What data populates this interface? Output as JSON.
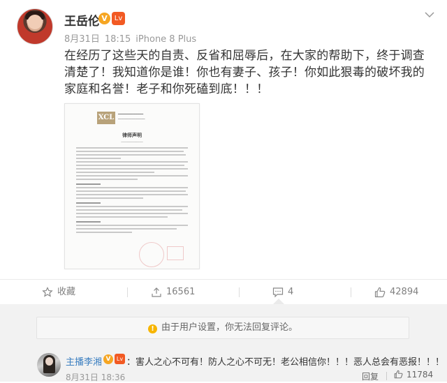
{
  "post": {
    "user_name": "王岳伦",
    "verified_badge": "V",
    "level_badge": "Lv",
    "date": "8月31日",
    "time": "18:15",
    "source": "iPhone 8 Plus",
    "text": "在经历了这些天的自责、反省和屈辱后，在大家的帮助下，终于调查清楚了！我知道你是谁！你也有妻子、孩子！你如此狠毒的破坏我的家庭和名誉！老子和你死磕到底！！！",
    "attachment": {
      "title": "律师声明",
      "logo_mark": "XCL"
    }
  },
  "actions": {
    "favorite_label": "收藏",
    "repost_count": "16561",
    "comment_count": "4",
    "like_count": "42894"
  },
  "comments": {
    "notice": "由于用户设置，你无法回复评论。",
    "items": [
      {
        "user_name": "主播李湘",
        "verified_badge": "V",
        "level_badge": "Lv",
        "text": "：害人之心不可有！防人之心不可无！老公相信你！！！恶人总会有恶报！！！",
        "time": "8月31日 18:36",
        "reply_label": "回复",
        "like_count": "11784"
      }
    ]
  },
  "icons": {
    "more": "chevron-down-icon",
    "favorite": "star-icon",
    "repost": "repost-icon",
    "comment": "comment-icon",
    "like": "thumbs-up-icon",
    "warning": "warning-icon"
  },
  "colors": {
    "link": "#3a7ec0",
    "meta": "#999999",
    "verified": "#f6a623",
    "level": "#f25a23"
  }
}
